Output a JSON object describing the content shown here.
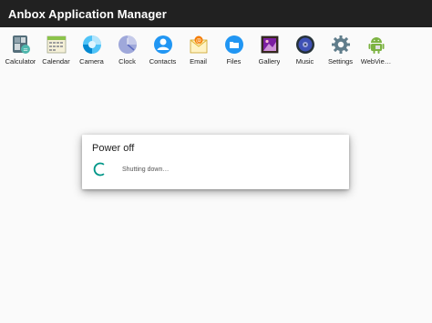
{
  "window": {
    "title": "Anbox Application Manager"
  },
  "apps": [
    {
      "label": "Calculator",
      "icon": "calculator-icon"
    },
    {
      "label": "Calendar",
      "icon": "calendar-icon"
    },
    {
      "label": "Camera",
      "icon": "camera-icon"
    },
    {
      "label": "Clock",
      "icon": "clock-icon"
    },
    {
      "label": "Contacts",
      "icon": "contacts-icon"
    },
    {
      "label": "Email",
      "icon": "email-icon"
    },
    {
      "label": "Files",
      "icon": "files-icon"
    },
    {
      "label": "Gallery",
      "icon": "gallery-icon"
    },
    {
      "label": "Music",
      "icon": "music-icon"
    },
    {
      "label": "Settings",
      "icon": "settings-icon"
    },
    {
      "label": "WebVie…",
      "icon": "android-icon"
    }
  ],
  "dialog": {
    "title": "Power off",
    "message": "Shutting down…",
    "spinner_icon": "progress-spinner-icon",
    "accent": "#009688"
  },
  "colors": {
    "titlebar": "#212121",
    "background": "#fafafa"
  }
}
